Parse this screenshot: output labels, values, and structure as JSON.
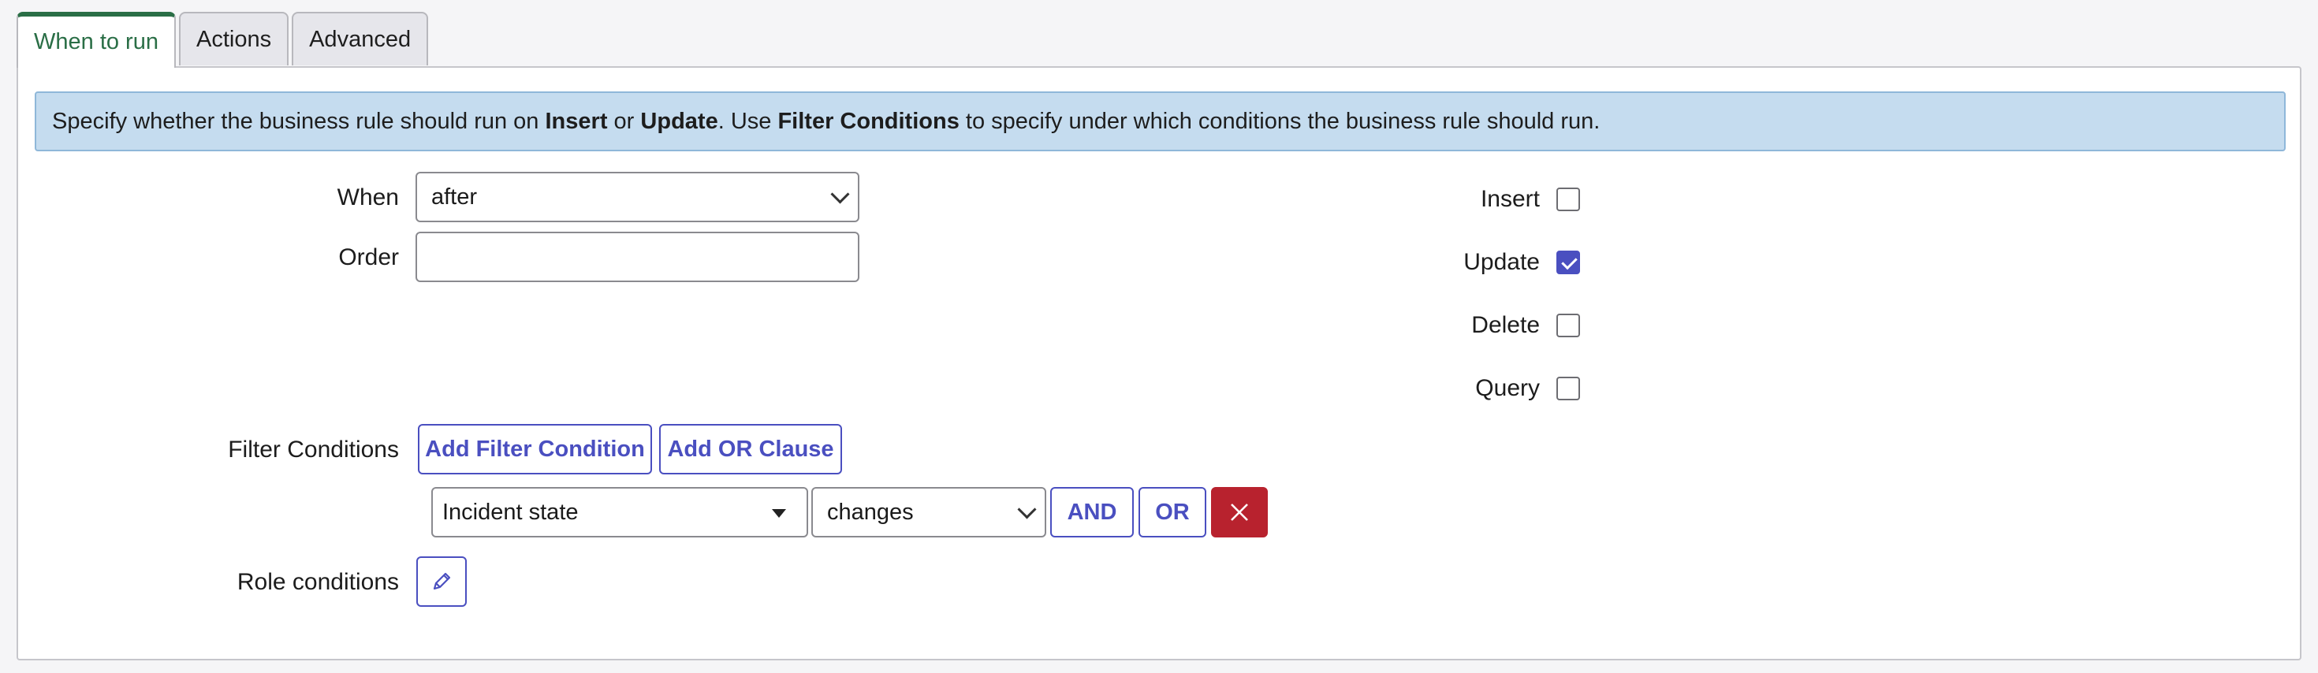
{
  "tabs": [
    {
      "label": "When to run",
      "active": true
    },
    {
      "label": "Actions",
      "active": false
    },
    {
      "label": "Advanced",
      "active": false
    }
  ],
  "banner": {
    "t1": "Specify whether the business rule should run on ",
    "b1": "Insert",
    "t2": " or ",
    "b2": "Update",
    "t3": ". Use ",
    "b3": "Filter Conditions",
    "t4": " to specify under which conditions the business rule should run."
  },
  "form": {
    "when_label": "When",
    "when_value": "after",
    "order_label": "Order",
    "order_value": "",
    "filter_label": "Filter Conditions",
    "role_label": "Role conditions"
  },
  "operations": [
    {
      "label": "Insert",
      "checked": false
    },
    {
      "label": "Update",
      "checked": true
    },
    {
      "label": "Delete",
      "checked": false
    },
    {
      "label": "Query",
      "checked": false
    }
  ],
  "filter": {
    "add_condition": "Add Filter Condition",
    "add_or": "Add OR Clause",
    "field": "Incident state",
    "operator": "changes",
    "and_label": "AND",
    "or_label": "OR"
  },
  "colors": {
    "accent": "#4a4fc0",
    "active_tab": "#2a6e46",
    "delete": "#b8222e",
    "banner": "#c5dcef"
  },
  "icons": {
    "delete": "close-icon",
    "role_edit": "pencil-icon"
  }
}
